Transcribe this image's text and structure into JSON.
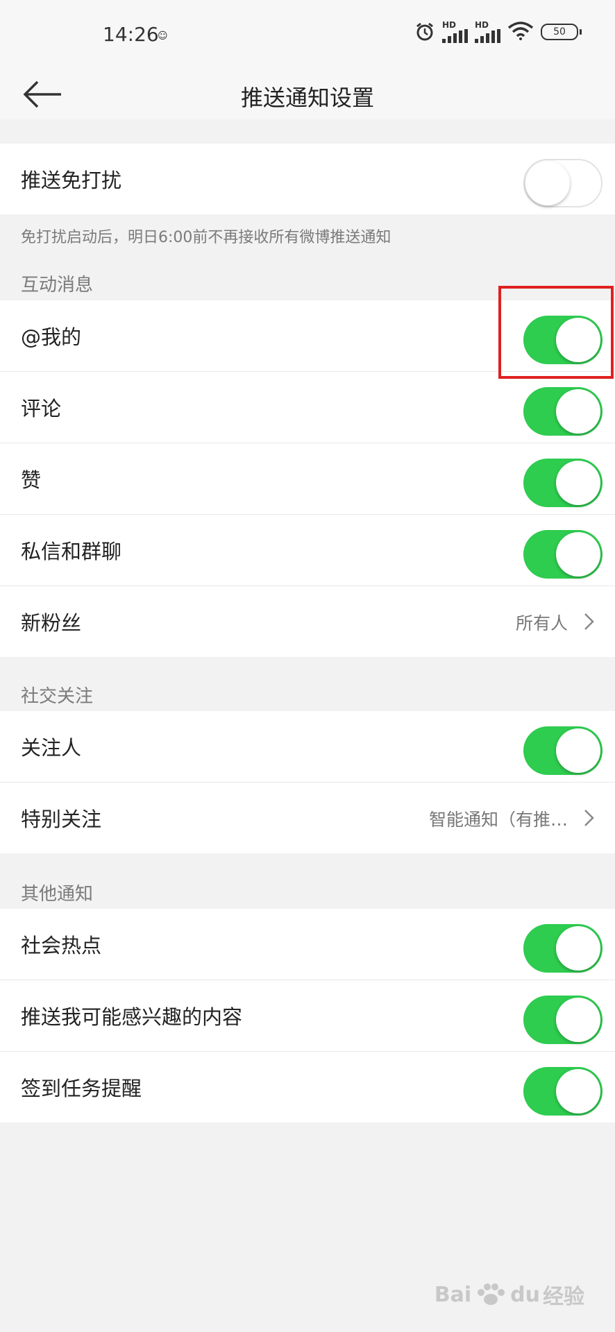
{
  "status_bar": {
    "time": "14:26",
    "battery": "50",
    "signal_label_1": "HD",
    "signal_label_2": "HD",
    "icons": [
      "alarm-icon",
      "signal-icon",
      "signal-icon",
      "wifi-icon",
      "battery-icon"
    ]
  },
  "nav": {
    "title": "推送通知设置",
    "back_icon": "back-arrow-icon"
  },
  "dnd": {
    "label": "推送免打扰",
    "enabled": false,
    "hint": "免打扰启动后，明日6:00前不再接收所有微博推送通知"
  },
  "interaction": {
    "header": "互动消息",
    "items": [
      {
        "label": "@我的",
        "enabled": true
      },
      {
        "label": "评论",
        "enabled": true
      },
      {
        "label": "赞",
        "enabled": true
      },
      {
        "label": "私信和群聊",
        "enabled": true
      },
      {
        "label": "新粉丝",
        "value": "所有人"
      }
    ]
  },
  "social": {
    "header": "社交关注",
    "items": [
      {
        "label": "关注人",
        "enabled": true
      },
      {
        "label": "特别关注",
        "value": "智能通知（有推…"
      }
    ]
  },
  "other": {
    "header": "其他通知",
    "items": [
      {
        "label": "社会热点",
        "enabled": true
      },
      {
        "label": "推送我可能感兴趣的内容",
        "enabled": true
      },
      {
        "label": "签到任务提醒",
        "enabled": true
      }
    ]
  },
  "colors": {
    "toggle_on": "#2ecc4f",
    "highlight": "#e02020"
  },
  "watermark": {
    "text_1": "Bai",
    "text_2": "du",
    "text_3": "经验"
  }
}
